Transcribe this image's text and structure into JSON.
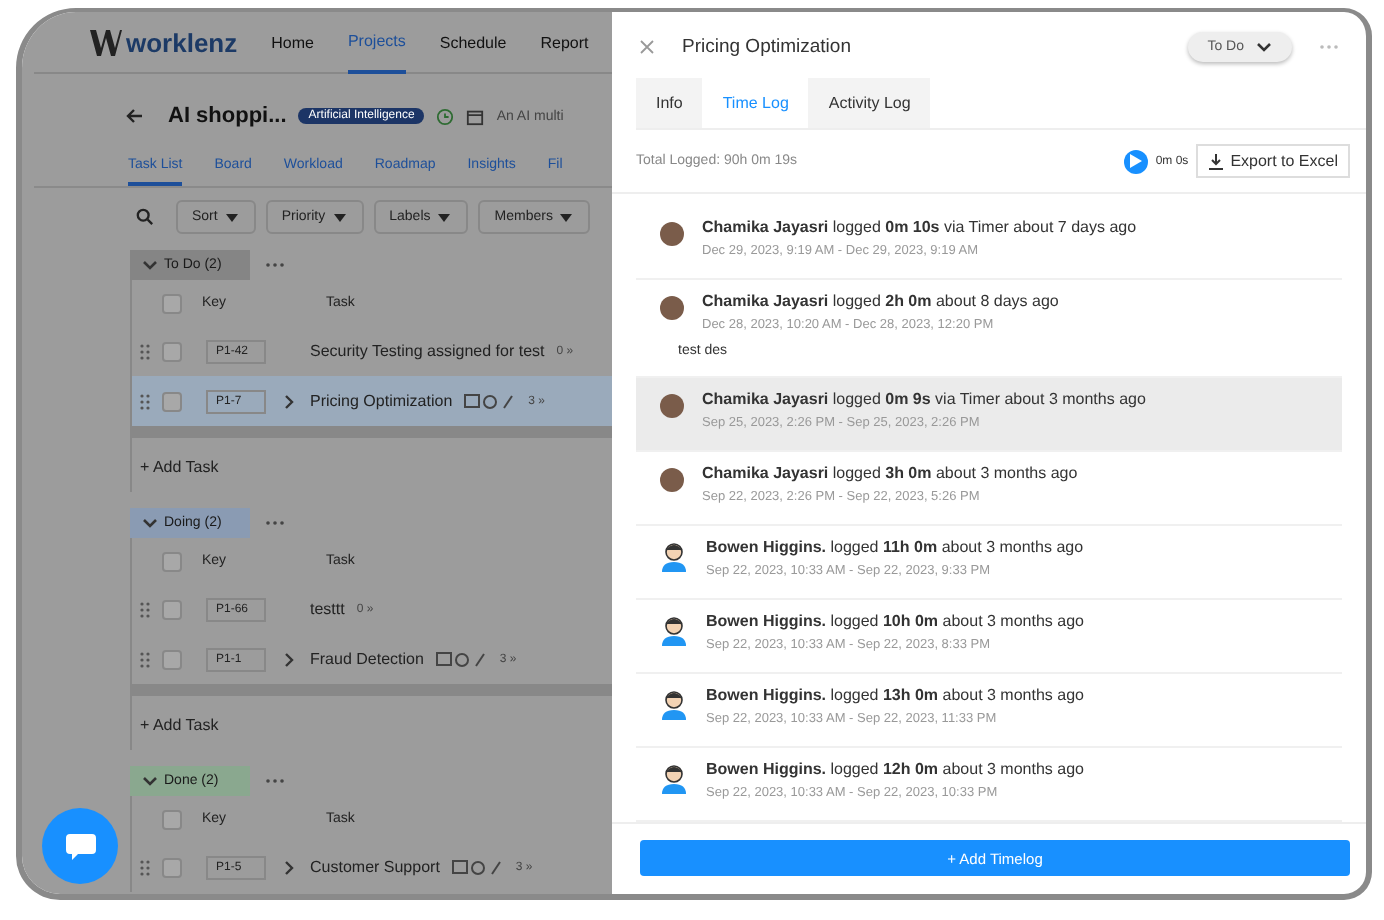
{
  "app": {
    "logo": "worklenz",
    "nav": [
      {
        "label": "Home",
        "selected": false
      },
      {
        "label": "Projects",
        "selected": true
      },
      {
        "label": "Schedule",
        "selected": false
      },
      {
        "label": "Report",
        "selected": false
      }
    ],
    "project": {
      "title": "AI shoppi...",
      "category": "Artificial Intelligence",
      "description": "An AI multi"
    },
    "tabs": [
      {
        "label": "Task List",
        "selected": true
      },
      {
        "label": "Board",
        "selected": false
      },
      {
        "label": "Workload",
        "selected": false
      },
      {
        "label": "Roadmap",
        "selected": false
      },
      {
        "label": "Insights",
        "selected": false
      },
      {
        "label": "Fil",
        "selected": false
      }
    ],
    "filters": [
      "Sort",
      "Priority",
      "Labels",
      "Members"
    ],
    "groups": [
      {
        "name": "To Do (2)",
        "color": "#858585",
        "all_checked": false,
        "columns": [
          "Key",
          "Task"
        ],
        "add_task": "+ Add Task",
        "rows": [
          {
            "key": "P1-42",
            "task": "Security Testing assigned for test",
            "count": "0 »",
            "subtasks": false,
            "icons": false,
            "selected": false
          },
          {
            "key": "P1-7",
            "task": "Pricing Optimization",
            "count": "3 »",
            "subtasks": true,
            "icons": true,
            "selected": true
          }
        ]
      },
      {
        "name": "Doing (2)",
        "color": "#8a9bb3",
        "all_checked": false,
        "columns": [
          "Key",
          "Task"
        ],
        "add_task": "+ Add Task",
        "rows": [
          {
            "key": "P1-66",
            "task": "testtt",
            "count": "0 »",
            "subtasks": false,
            "icons": false,
            "selected": false
          },
          {
            "key": "P1-1",
            "task": "Fraud Detection",
            "count": "3 »",
            "subtasks": true,
            "icons": true,
            "selected": false
          }
        ]
      },
      {
        "name": "Done (2)",
        "color": "#8aa88f",
        "all_checked": false,
        "columns": [
          "Key",
          "Task"
        ],
        "rows": [
          {
            "key": "P1-5",
            "task": "Customer Support",
            "count": "3 »",
            "subtasks": true,
            "icons": true,
            "selected": false
          }
        ]
      }
    ]
  },
  "drawer": {
    "title": "Pricing Optimization",
    "status": "To Do",
    "tabs": [
      {
        "label": "Info",
        "selected": false
      },
      {
        "label": "Time Log",
        "selected": true
      },
      {
        "label": "Activity Log",
        "selected": false
      }
    ],
    "total": "Total Logged: 90h 0m 19s",
    "timer": "0m 0s",
    "export": "Export to Excel",
    "logs": [
      {
        "kind": "photo",
        "text": "**Chamika Jayasri** logged **0m 10s** via Timer about 7 days ago",
        "range": "Dec 29, 2023, 9:19 AM - Dec 29, 2023, 9:19 AM",
        "selected": false
      },
      {
        "kind": "photo",
        "text": "**Chamika Jayasri** logged **2h 0m** about 8 days ago",
        "range": "Dec 28, 2023, 10:20 AM - Dec 28, 2023, 12:20 PM",
        "note": "test des",
        "selected": false
      },
      {
        "kind": "photo",
        "text": "**Chamika Jayasri** logged **0m 9s** via Timer about 3 months ago",
        "range": "Sep 25, 2023, 2:26 PM - Sep 25, 2023, 2:26 PM",
        "selected": true
      },
      {
        "kind": "photo",
        "text": "**Chamika Jayasri** logged **3h 0m** about 3 months ago",
        "range": "Sep 22, 2023, 2:26 PM - Sep 22, 2023, 5:26 PM",
        "selected": false
      },
      {
        "kind": "cartoon",
        "text": "**Bowen Higgins.** logged **11h 0m** about 3 months ago",
        "range": "Sep 22, 2023, 10:33 AM - Sep 22, 2023, 9:33 PM",
        "selected": false
      },
      {
        "kind": "cartoon",
        "text": "**Bowen Higgins.** logged **10h 0m** about 3 months ago",
        "range": "Sep 22, 2023, 10:33 AM - Sep 22, 2023, 8:33 PM",
        "selected": false
      },
      {
        "kind": "cartoon",
        "text": "**Bowen Higgins.** logged **13h 0m** about 3 months ago",
        "range": "Sep 22, 2023, 10:33 AM - Sep 22, 2023, 11:33 PM",
        "selected": false
      },
      {
        "kind": "cartoon",
        "text": "**Bowen Higgins.** logged **12h 0m** about 3 months ago",
        "range": "Sep 22, 2023, 10:33 AM - Sep 22, 2023, 10:33 PM",
        "selected": false
      }
    ],
    "add_button": "+ Add Timelog"
  }
}
